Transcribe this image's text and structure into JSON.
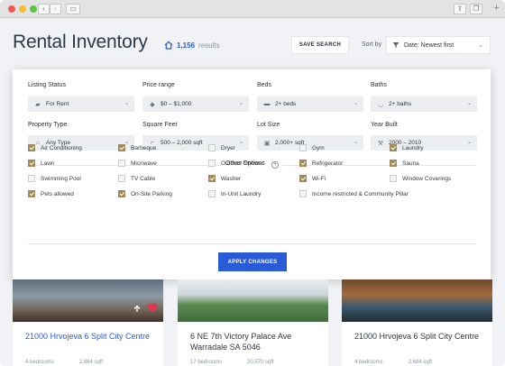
{
  "window": {
    "back_glyph": "‹",
    "forward_glyph": "›",
    "sidebar_glyph": "▭",
    "share_glyph": "⇧",
    "tabs_glyph": "❐",
    "new_tab_glyph": "+"
  },
  "header": {
    "title": "Rental Inventory",
    "results_count": "1,156",
    "results_label": "results",
    "save_search_label": "SAVE SEARCH",
    "sort_label": "Sort by",
    "sort_value": "Date: Newest first"
  },
  "filters": {
    "listing_status": {
      "label": "Listing Status",
      "value": "For Rent"
    },
    "price_range": {
      "label": "Price range",
      "value": "$0 – $1,000"
    },
    "beds": {
      "label": "Beds",
      "value": "2+ beds"
    },
    "baths": {
      "label": "Baths",
      "value": "2+ baths"
    },
    "property_type": {
      "label": "Property Type",
      "value": "Any Type"
    },
    "square_feet": {
      "label": "Square Feet",
      "value": "500 – 2,000 sqft"
    },
    "lot_size": {
      "label": "Lot Size",
      "value": "2,000+ sqft"
    },
    "year_built": {
      "label": "Year Built",
      "value": "2000 – 2010"
    }
  },
  "other_options": {
    "label": "Other Options",
    "amenities": [
      {
        "label": "Air Conditioning",
        "checked": true
      },
      {
        "label": "Barbeque",
        "checked": true
      },
      {
        "label": "Dryer",
        "checked": false
      },
      {
        "label": "Gym",
        "checked": false
      },
      {
        "label": "Laundry",
        "checked": true
      },
      {
        "label": "Lawn",
        "checked": true
      },
      {
        "label": "Micriwave",
        "checked": false
      },
      {
        "label": "Outdoor Shower",
        "checked": false
      },
      {
        "label": "Refrigerator",
        "checked": true
      },
      {
        "label": "Sauna",
        "checked": true
      },
      {
        "label": "Swimming Pool",
        "checked": false
      },
      {
        "label": "TV Cable",
        "checked": false
      },
      {
        "label": "Washer",
        "checked": true
      },
      {
        "label": "Wi-Fi",
        "checked": true
      },
      {
        "label": "Window Coverings",
        "checked": false
      },
      {
        "label": "Pets allowed",
        "checked": true
      },
      {
        "label": "On-Site Parking",
        "checked": true
      },
      {
        "label": "In-Unit Laundry",
        "checked": false
      },
      {
        "label": "Income restricted & Community Pillar",
        "checked": false
      }
    ]
  },
  "apply_label": "APPLY CHANGES",
  "listings": [
    {
      "address": "21000 Hrvojeva 6 Split City Centre",
      "beds": "4 bedrooms",
      "sqft": "2,684 sqft",
      "address_color": "#2a5bd7"
    },
    {
      "address": "6 NE 7th Victory Palace Ave Warradale SA 5046",
      "beds": "17 bedrooms",
      "sqft": "20,570 sqft",
      "address_color": "#2f3640"
    },
    {
      "address": "21000 Hrvojeva 6 Split City Centre",
      "beds": "4 bedrooms",
      "sqft": "2,684 sqft",
      "address_color": "#2f3640"
    }
  ],
  "colors": {
    "accent": "#2a5bd7",
    "checkbox": "#a08a5a",
    "favorite": "#e0374d"
  }
}
